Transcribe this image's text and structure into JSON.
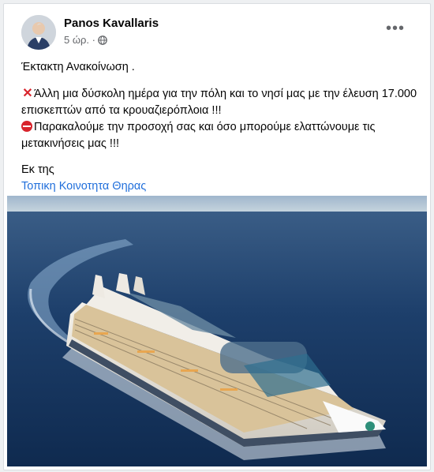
{
  "post": {
    "author": "Panos Kavallaris",
    "time": "5 ώρ. ·",
    "audience_icon": "globe-icon",
    "more_icon": "more-options-icon",
    "more_label": "•••",
    "lines": {
      "title": "Έκτακτη Ανακοίνωση .",
      "line1_icon": "red-cross-mark-icon",
      "line1_text": "Άλλη μια δύσκολη ημέρα για την πόλη και το νησί μας με την έλευση 17.000 επισκεπτών από τα κρουαζιερόπλοια !!!",
      "line2_icon": "no-entry-icon",
      "line2_text": "Παρακαλούμε την προσοχή σας και όσο μπορούμε ελαττώνουμε τις μετακινήσεις μας !!!",
      "source_label": "Εκ της",
      "source_link": "Τοπικη Κοινοτητα Θηρας"
    },
    "image": "cruise-ship-photo"
  },
  "colors": {
    "link": "#216fdb",
    "sea": "#16345e",
    "muted": "#65676b"
  }
}
